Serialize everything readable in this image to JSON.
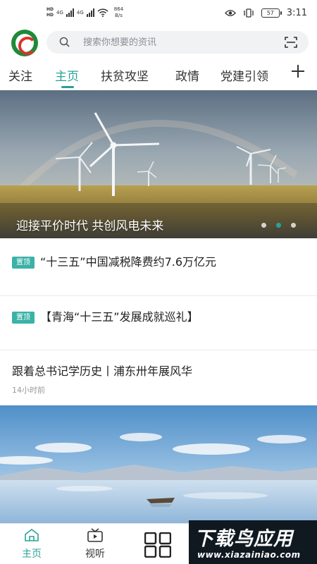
{
  "status_bar": {
    "hd_top": "HD",
    "hd_bottom": "HD",
    "signal_1": "4G",
    "signal_2": "4G",
    "net_speed": "864",
    "net_unit": "B/s",
    "battery": "57",
    "time": "3:11"
  },
  "header": {
    "logo_icon": "news-app-logo",
    "search_placeholder": "搜索你想要的资讯",
    "search_value": "",
    "scan_icon": "scan-icon"
  },
  "tabs": [
    {
      "label": "关注",
      "active": false
    },
    {
      "label": "主页",
      "active": true
    },
    {
      "label": "扶贫攻坚",
      "active": false
    },
    {
      "label": "政情",
      "active": false
    },
    {
      "label": "党建引领",
      "active": false
    }
  ],
  "banner": {
    "caption": "迎接平价时代  共创风电未来",
    "slide_count": 3,
    "active_slide": 2
  },
  "news": [
    {
      "badge": "置顶",
      "title": "“十三五”中国减税降费约7.6万亿元",
      "time": ""
    },
    {
      "badge": "置顶",
      "title": "【青海“十三五”发展成就巡礼】",
      "time": ""
    },
    {
      "badge": "",
      "title": "跟着总书记学历史丨浦东卅年展风华",
      "time": "14小时前"
    }
  ],
  "bottom_nav": [
    {
      "label": "主页",
      "icon": "home-icon",
      "active": true
    },
    {
      "label": "视听",
      "icon": "video-icon",
      "active": false
    },
    {
      "label": "",
      "icon": "grid-icon",
      "active": false
    }
  ],
  "watermark": {
    "title": "下载鸟应用",
    "url": "www.xiazainiao.com"
  },
  "colors": {
    "accent": "#2aa198",
    "badge": "#3bb2a6",
    "text": "#222222",
    "muted": "#9a9a9a"
  }
}
